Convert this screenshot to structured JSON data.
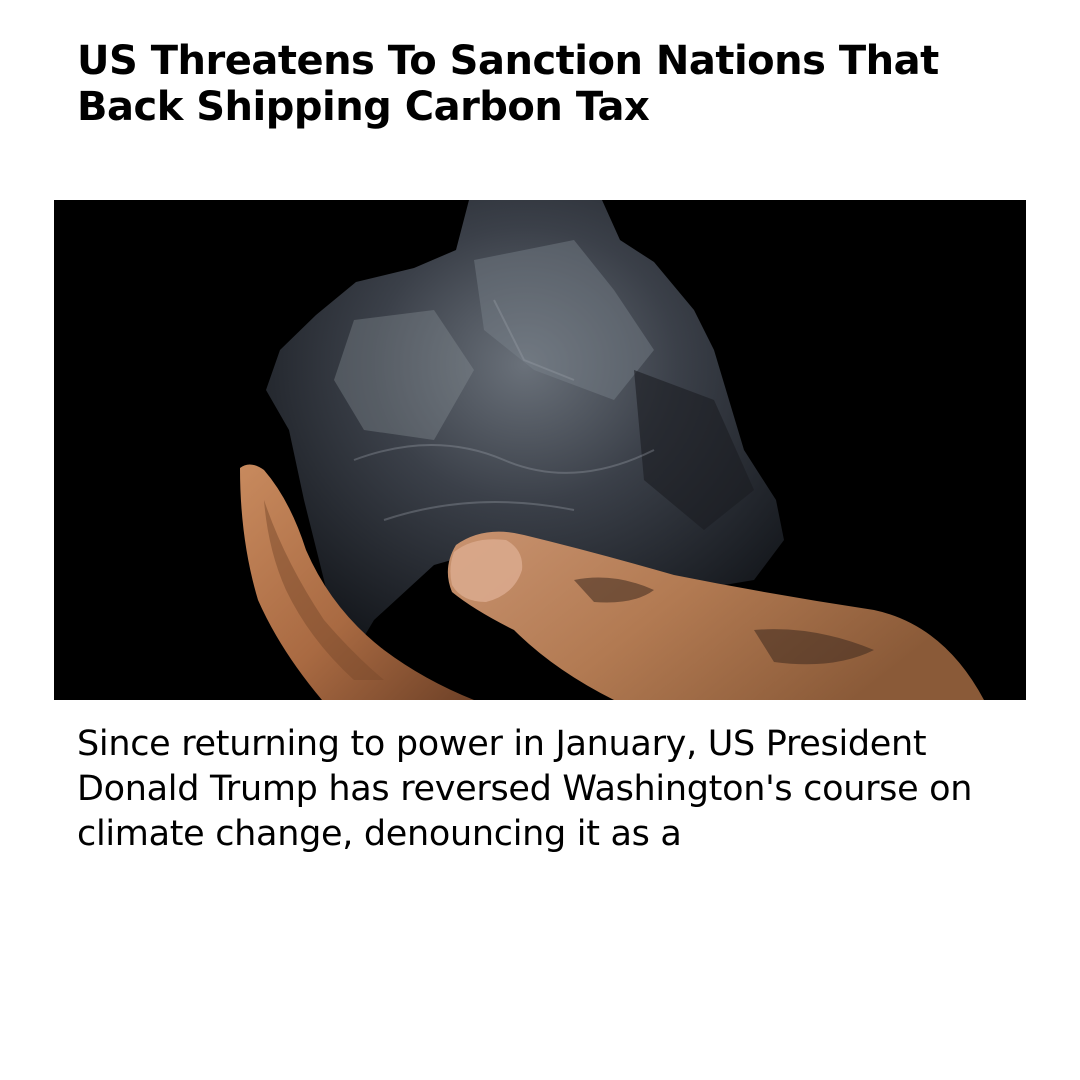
{
  "article": {
    "headline": "US Threatens To Sanction Nations That Back Shipping Carbon Tax",
    "body": "Since returning to power in January, US President Donald Trump has reversed Washington's course on climate change, denouncing it as a"
  },
  "image": {
    "subject": "hand-holding-coal",
    "colors": {
      "background": "#000000",
      "coal": "#2b3038",
      "coal_highlight": "#5f666f",
      "skin": "#b7764c",
      "skin_dark": "#7a4a2c"
    }
  }
}
